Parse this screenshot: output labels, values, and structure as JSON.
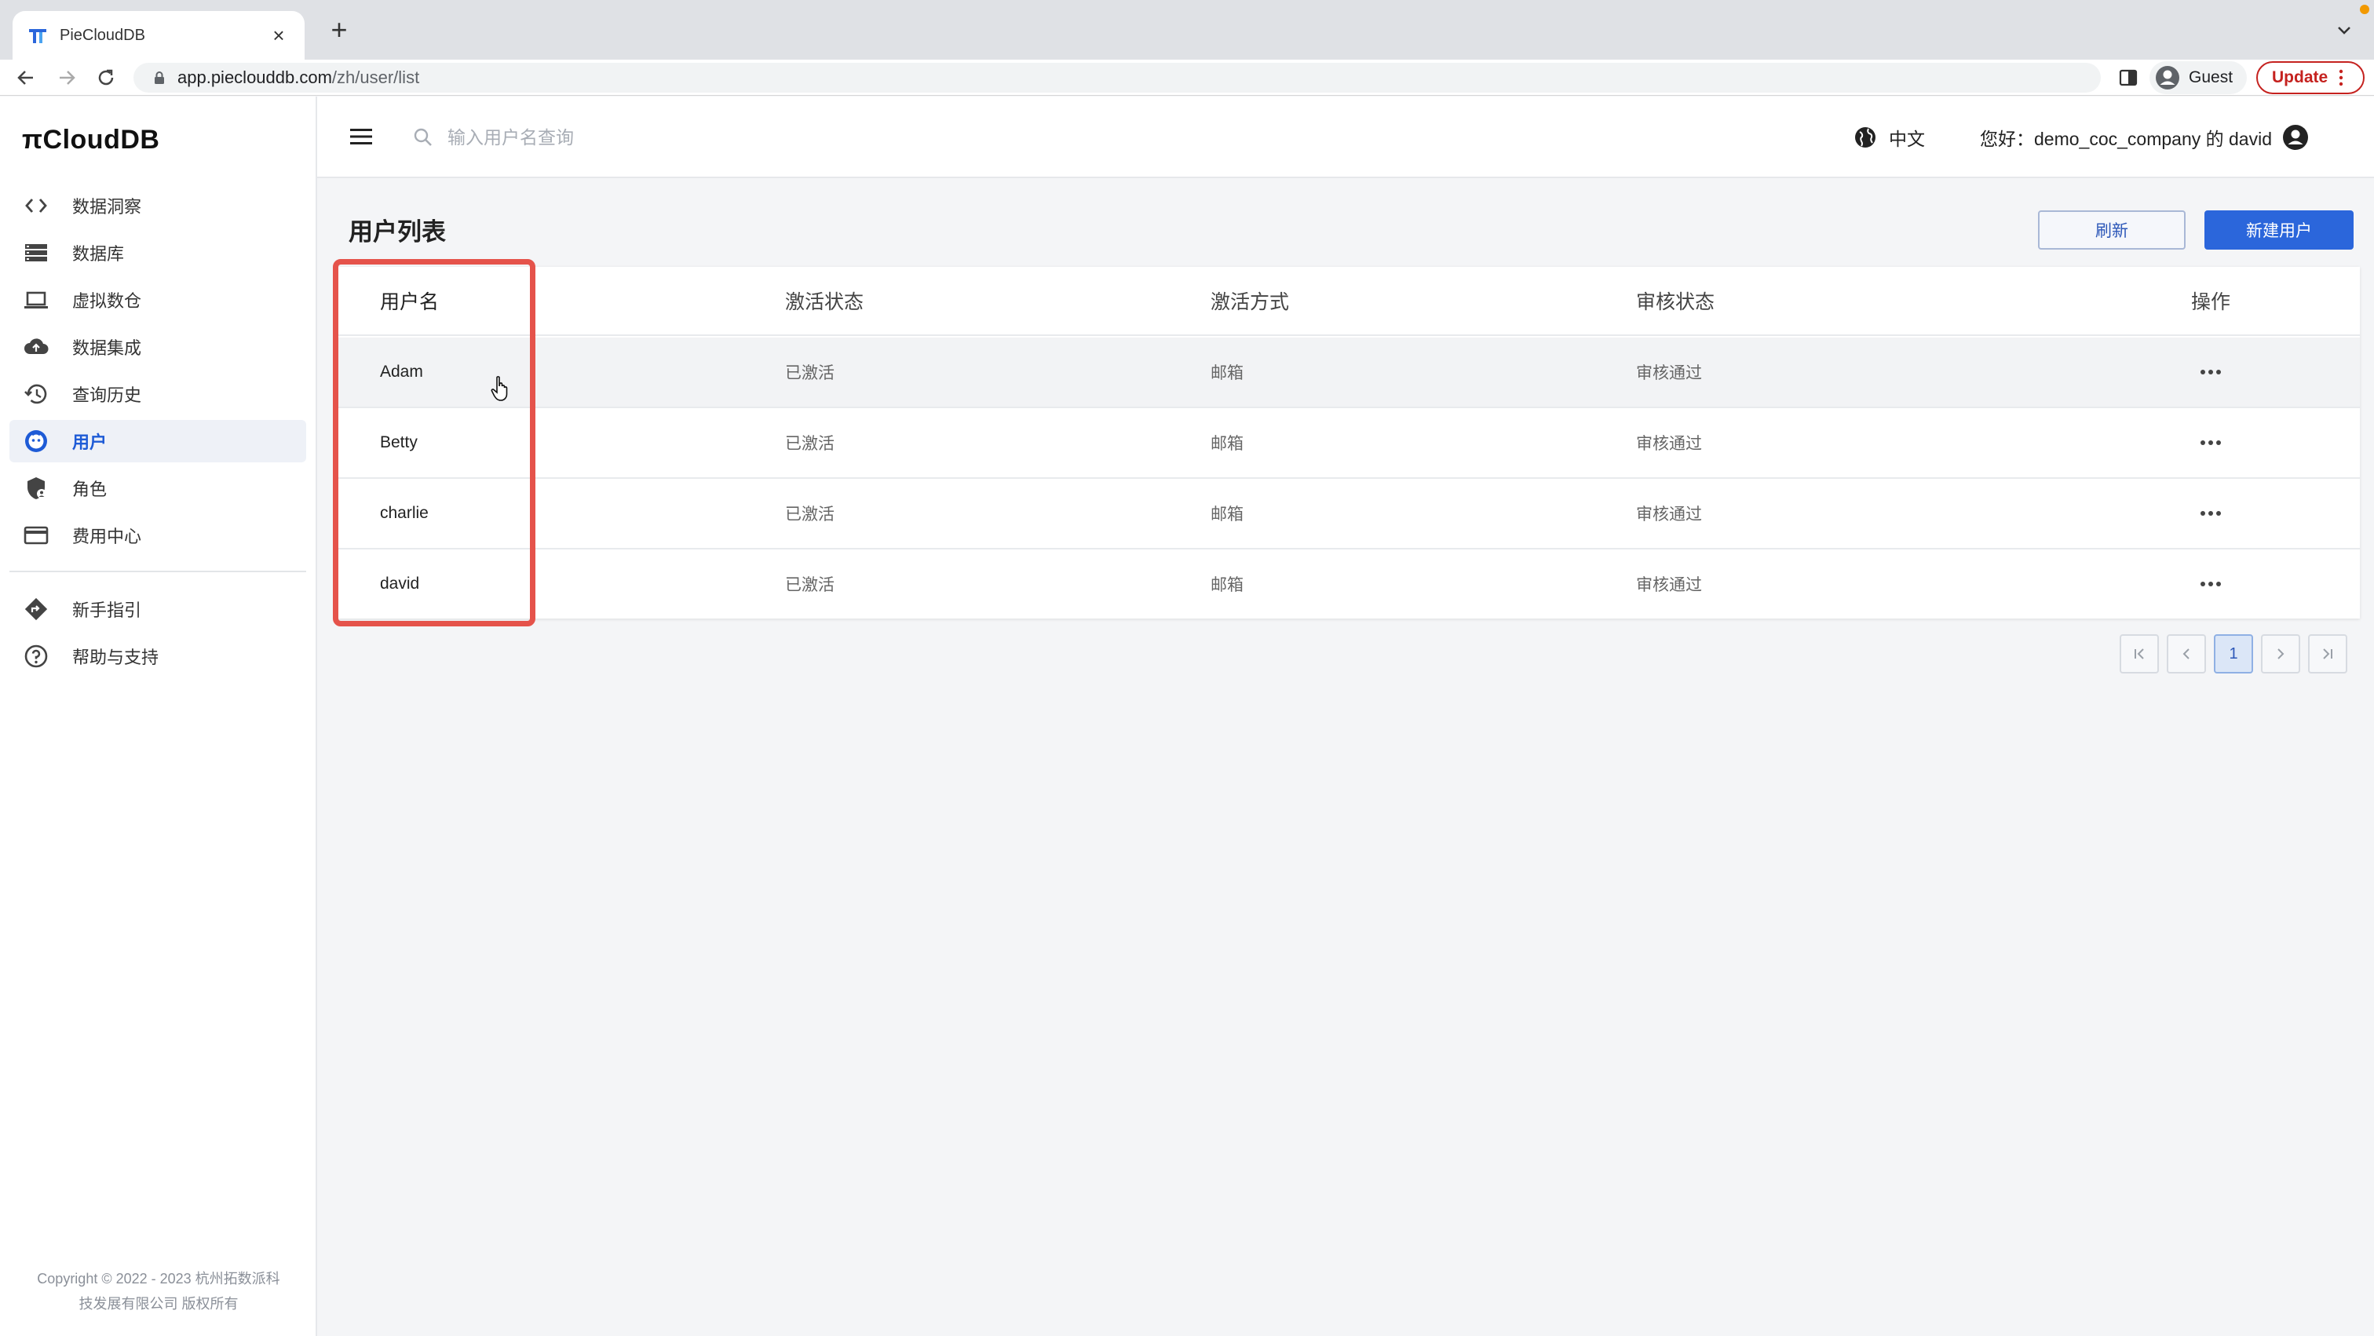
{
  "browser": {
    "tab_title": "PieCloudDB",
    "tab_close": "×",
    "new_tab": "+",
    "url_host": "app.pieclouddb.com",
    "url_path": "/zh/user/list",
    "profile_label": "Guest",
    "update_label": "Update"
  },
  "sidebar": {
    "logo_text": "πCloudDB",
    "items": [
      {
        "label": "数据洞察",
        "icon": "code-icon",
        "active": false
      },
      {
        "label": "数据库",
        "icon": "database-icon",
        "active": false
      },
      {
        "label": "虚拟数仓",
        "icon": "laptop-icon",
        "active": false
      },
      {
        "label": "数据集成",
        "icon": "cloud-upload-icon",
        "active": false
      },
      {
        "label": "查询历史",
        "icon": "history-icon",
        "active": false
      },
      {
        "label": "用户",
        "icon": "user-face-icon",
        "active": true
      },
      {
        "label": "角色",
        "icon": "shield-icon",
        "active": false
      },
      {
        "label": "费用中心",
        "icon": "credit-card-icon",
        "active": false
      }
    ],
    "bottom_items": [
      {
        "label": "新手指引",
        "icon": "directions-icon"
      },
      {
        "label": "帮助与支持",
        "icon": "help-icon"
      }
    ],
    "copyright_line1": "Copyright © 2022 - 2023 杭州拓数派科",
    "copyright_line2": "技发展有限公司 版权所有"
  },
  "header": {
    "search_placeholder": "输入用户名查询",
    "language": "中文",
    "greeting": "您好：demo_coc_company 的 david"
  },
  "main": {
    "title": "用户列表",
    "refresh_label": "刷新",
    "new_user_label": "新建用户",
    "columns": [
      "用户名",
      "激活状态",
      "激活方式",
      "审核状态",
      "操作"
    ],
    "rows": [
      {
        "name": "Adam",
        "activation": "已激活",
        "method": "邮箱",
        "review": "审核通过"
      },
      {
        "name": "Betty",
        "activation": "已激活",
        "method": "邮箱",
        "review": "审核通过"
      },
      {
        "name": "charlie",
        "activation": "已激活",
        "method": "邮箱",
        "review": "审核通过"
      },
      {
        "name": "david",
        "activation": "已激活",
        "method": "邮箱",
        "review": "审核通过"
      }
    ],
    "pagination": {
      "current_page": "1"
    }
  },
  "colors": {
    "accent": "#2b66db",
    "active_nav": "#1e5bd6",
    "highlight": "#e5534b"
  }
}
